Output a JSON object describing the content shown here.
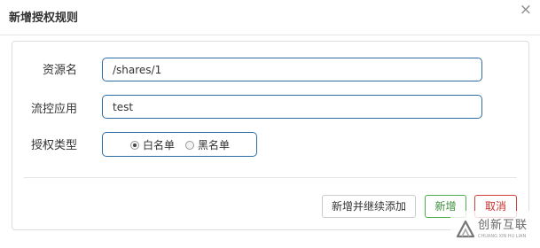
{
  "dialog": {
    "title": "新增授权规则",
    "close_glyph": "×"
  },
  "form": {
    "resource": {
      "label": "资源名",
      "value": "/shares/1"
    },
    "app": {
      "label": "流控应用",
      "value": "test"
    },
    "auth_type": {
      "label": "授权类型",
      "options": [
        {
          "label": "白名单",
          "checked": true
        },
        {
          "label": "黑名单",
          "checked": false
        }
      ]
    }
  },
  "buttons": {
    "add_continue": "新增并继续添加",
    "add": "新增",
    "cancel": "取消"
  },
  "watermark": {
    "name": "创新互联",
    "tagline": "CHUANG XIN HU LIAN"
  },
  "colors": {
    "input_border": "#2e6da4",
    "success": "#4cae4c",
    "danger": "#d43f3a"
  }
}
